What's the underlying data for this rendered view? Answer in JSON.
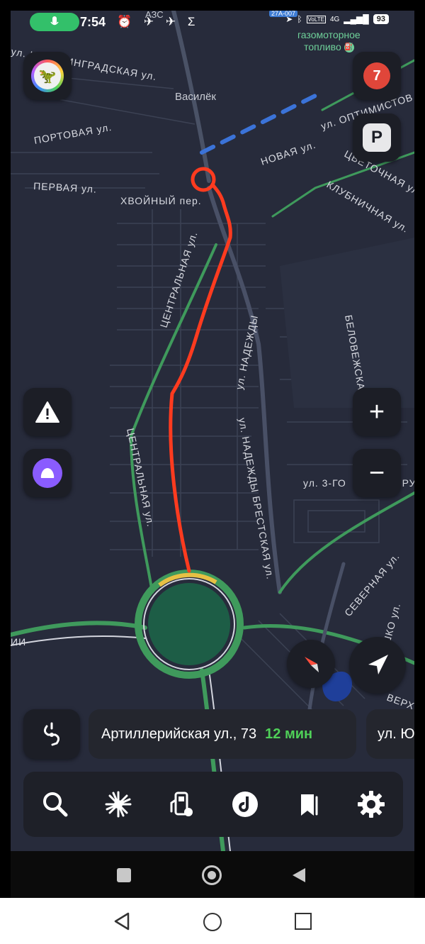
{
  "status_bar": {
    "time": "7:54",
    "azs_label": "АЗС",
    "carrier_badge": "27A-007",
    "network": "4G",
    "volte": "VoLTE",
    "battery": "93"
  },
  "map": {
    "poi_fuel": "газомоторное\nтопливо",
    "district_label": "Василёк",
    "streets": {
      "kaliningradskaya": "ул. КАЛИНИНГРАДСКАЯ ул.",
      "portovaya": "ПОРТОВАЯ ул.",
      "pervaya": "ПЕРВАЯ ул.",
      "khvoyny": "ХВОЙНЫЙ пер.",
      "novaya": "НОВАЯ ул.",
      "optimistov": "ул. ОПТИМИСТОВ",
      "tsvetochnaya": "ЦВЕТОЧНАЯ ул.",
      "klubnichnaya": "КЛУБНИЧНАЯ ул.",
      "tsentralnaya_1": "ЦЕНТРАЛЬНАЯ ул.",
      "tsentralnaya_2": "ЦЕНТРАЛЬНАЯ ул.",
      "nadezhdy": "ул. НАДЕЖДЫ",
      "nadezhdy_brestskaya": "ул. НАДЕЖДЫ БРЕСТСКАЯ ул.",
      "belovezhskaya": "БЕЛОВЕЖСКАЯ",
      "z_go": "ул. 3-ГО",
      "belorus": "БЕЛОРУСС",
      "severnaya": "СЕВЕРНАЯ ул.",
      "kostyushko": "КОСТЮШКО ул.",
      "verkh": "ВЕРХ",
      "left_road": "ИИ"
    }
  },
  "controls": {
    "notifications_count": "7",
    "parking_label": "P",
    "zoom_in": "+",
    "zoom_out": "−"
  },
  "route_bar": {
    "destination": "Артиллерийская ул., 73",
    "eta": "12 мин",
    "next_street": "ул. Ю"
  },
  "icons": {
    "mic": "mic-icon",
    "avatar": "dino-avatar-icon",
    "warning": "warning-icon",
    "alice": "alice-assistant-icon",
    "compass": "compass-icon",
    "locate": "navigation-arrow-icon",
    "search": "search-icon",
    "discover": "sparkle-icon",
    "fuel": "fuel-station-icon",
    "music": "music-icon",
    "bookmarks": "bookmarks-icon",
    "settings": "gear-icon"
  },
  "colors": {
    "map_bg": "#272b3b",
    "route_drawn": "#ff3b1f",
    "green_roads": "#3f9a5c",
    "eta": "#4fd058",
    "alice": "#8a5cff",
    "badge": "#e0463a"
  }
}
